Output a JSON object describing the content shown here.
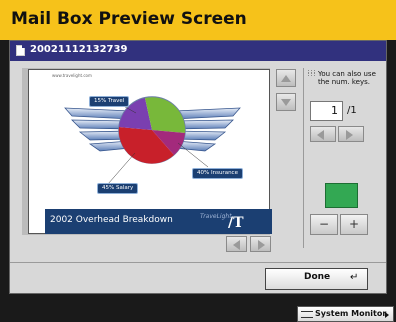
{
  "title": "Mail Box Preview Screen",
  "file": {
    "name": "20021112132739",
    "icon": "document-icon"
  },
  "preview": {
    "site": "www.travelight.com",
    "chart_title": "2002 Overhead Breakdown",
    "brand": "TraveLight",
    "brand_logo": "/T",
    "slices": [
      {
        "label": "15% Travel",
        "color": "#7a3fb0"
      },
      {
        "label": "40% Insurance",
        "color": "#78b83a"
      },
      {
        "label": "45% Salary",
        "color": "#c8202a"
      }
    ]
  },
  "controls": {
    "scroll_up_icon": "triangle-up-icon",
    "scroll_down_icon": "triangle-down-icon",
    "hint_icon": "numeric-keys-icon",
    "hint": "You can also use the num. keys.",
    "page_current": "1",
    "page_total": "/1",
    "zoom_out": "−",
    "zoom_in": "+",
    "swatch_color": "#33a853"
  },
  "done_label": "Done",
  "return_symbol": "↵",
  "system_monitor": "System Monitor"
}
